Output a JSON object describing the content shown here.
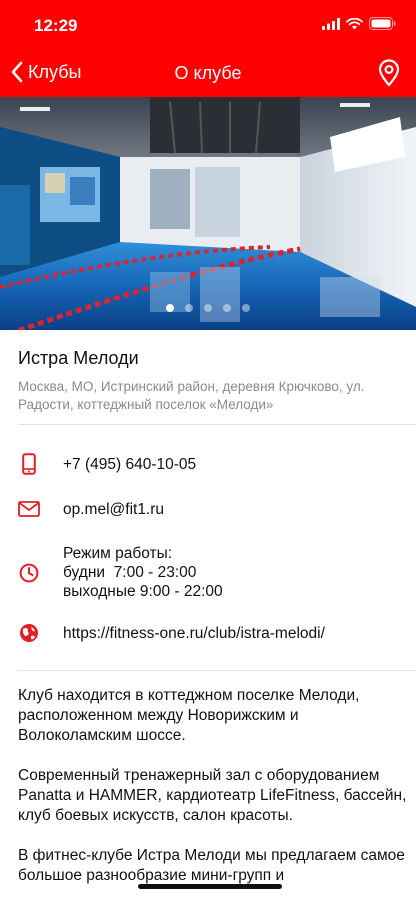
{
  "status_bar": {
    "time": "12:29"
  },
  "nav": {
    "back_label": "Клубы",
    "title": "О клубе"
  },
  "colors": {
    "brand_red": "#ff0000",
    "muted_text": "#8a8a8a"
  },
  "carousel": {
    "page_count": 5,
    "active_index": 0
  },
  "club": {
    "name": "Истра Мелоди",
    "address": "Москва, МО, Истринский район, деревня Крючково, ул. Радости, коттеджный поселок «Мелоди»"
  },
  "contacts": {
    "phone": "+7 (495) 640-10-05",
    "email": "op.mel@fit1.ru",
    "hours_title": "Режим работы:",
    "hours_weekdays": "будни  7:00 - 23:00",
    "hours_weekends": "выходные 9:00 - 22:00",
    "website": "https://fitness-one.ru/club/istra-melodi/"
  },
  "icons": {
    "back": "chevron-left-icon",
    "map": "map-pin-icon",
    "phone": "phone-icon",
    "email": "mail-icon",
    "hours": "clock-icon",
    "website": "globe-icon"
  },
  "description": {
    "p1": "Клуб находится в коттеджном поселке Мелоди, расположенном между Новорижским и Волоколамским шоссе.",
    "p2": "Современный тренажерный зал с оборудованием Panatta и HAMMER, кардиотеатр LifeFitness, бассейн, клуб боевых искусств, салон красоты.",
    "p3": "В фитнес-клубе Истра Мелоди мы предлагаем самое большое разнообразие мини-групп и"
  }
}
